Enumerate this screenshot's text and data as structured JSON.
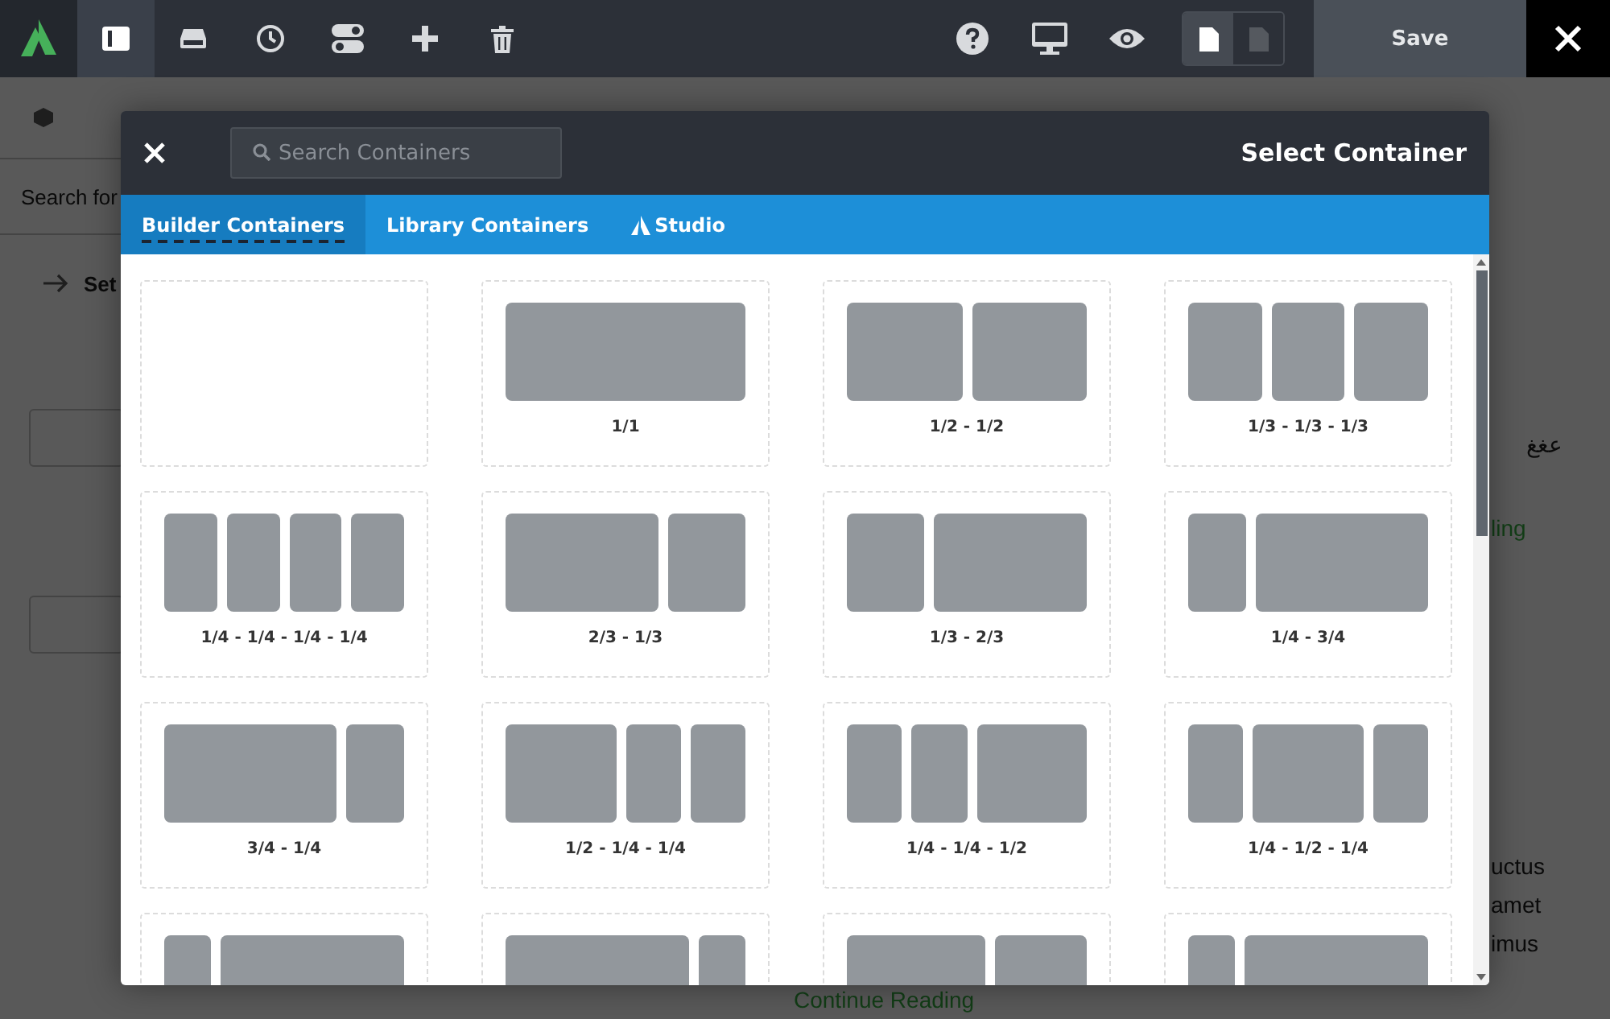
{
  "toolbar": {
    "tools": [
      {
        "selected": true
      },
      {
        "selected": false
      },
      {
        "selected": false
      },
      {
        "selected": false
      },
      {
        "selected": false
      },
      {
        "selected": false
      }
    ],
    "view_modes": [
      {
        "selected": true
      },
      {
        "selected": false
      }
    ],
    "save_label": "Save"
  },
  "background": {
    "sidebar_search": "Search for",
    "sidebar_heading": "Set",
    "fragments": [
      "عغغ",
      "ling",
      "uctus",
      "amet",
      "imus"
    ],
    "continue_link": "Continue Reading"
  },
  "modal": {
    "title": "Select Container",
    "search": {
      "placeholder": "Search Containers"
    },
    "tabs": [
      {
        "label": "Builder Containers",
        "selected": true,
        "icon": false
      },
      {
        "label": "Library Containers",
        "selected": false,
        "icon": false
      },
      {
        "label": "Studio",
        "selected": false,
        "icon": true
      }
    ],
    "layouts": [
      {
        "kind": "blank"
      },
      {
        "label": "1/1",
        "blocks": [
          {
            "kind": "full"
          }
        ]
      },
      {
        "label": "1/2 - 1/2",
        "blocks": [
          {
            "kind": "half"
          },
          {
            "kind": "half"
          }
        ]
      },
      {
        "label": "1/3 - 1/3 - 1/3",
        "blocks": [
          {
            "kind": "third"
          },
          {
            "kind": "third"
          },
          {
            "kind": "third"
          }
        ]
      },
      {
        "label": "1/4 - 1/4 - 1/4 - 1/4",
        "blocks": [
          {
            "kind": "quarter"
          },
          {
            "kind": "quarter"
          },
          {
            "kind": "quarter"
          },
          {
            "kind": "quarter"
          }
        ]
      },
      {
        "label": "2/3 - 1/3",
        "blocks": [
          {
            "kind": "two-thirds"
          },
          {
            "kind": "third"
          }
        ]
      },
      {
        "label": "1/3 - 2/3",
        "blocks": [
          {
            "kind": "third"
          },
          {
            "kind": "two-thirds"
          }
        ]
      },
      {
        "label": "1/4 - 3/4",
        "blocks": [
          {
            "kind": "quarter"
          },
          {
            "kind": "three-quarters"
          }
        ]
      },
      {
        "label": "3/4 - 1/4",
        "blocks": [
          {
            "kind": "three-quarters"
          },
          {
            "kind": "quarter"
          }
        ]
      },
      {
        "label": "1/2 - 1/4 - 1/4",
        "blocks": [
          {
            "kind": "half"
          },
          {
            "kind": "quarter"
          },
          {
            "kind": "quarter"
          }
        ]
      },
      {
        "label": "1/4 - 1/4 - 1/2",
        "blocks": [
          {
            "kind": "quarter"
          },
          {
            "kind": "quarter"
          },
          {
            "kind": "half"
          }
        ]
      },
      {
        "label": "1/4 - 1/2 - 1/4",
        "blocks": [
          {
            "kind": "quarter"
          },
          {
            "kind": "half"
          },
          {
            "kind": "quarter"
          }
        ]
      },
      {
        "blocks": [
          {
            "kind": "fifth"
          },
          {
            "kind": "four-fifths"
          }
        ]
      },
      {
        "blocks": [
          {
            "kind": "four-fifths"
          },
          {
            "kind": "fifth"
          }
        ]
      },
      {
        "blocks": [
          {
            "kind": "three-fifths"
          },
          {
            "kind": "two-fifths"
          }
        ]
      },
      {
        "blocks": [
          {
            "kind": "fifth"
          },
          {
            "kind": "four-fifths"
          }
        ]
      }
    ]
  }
}
